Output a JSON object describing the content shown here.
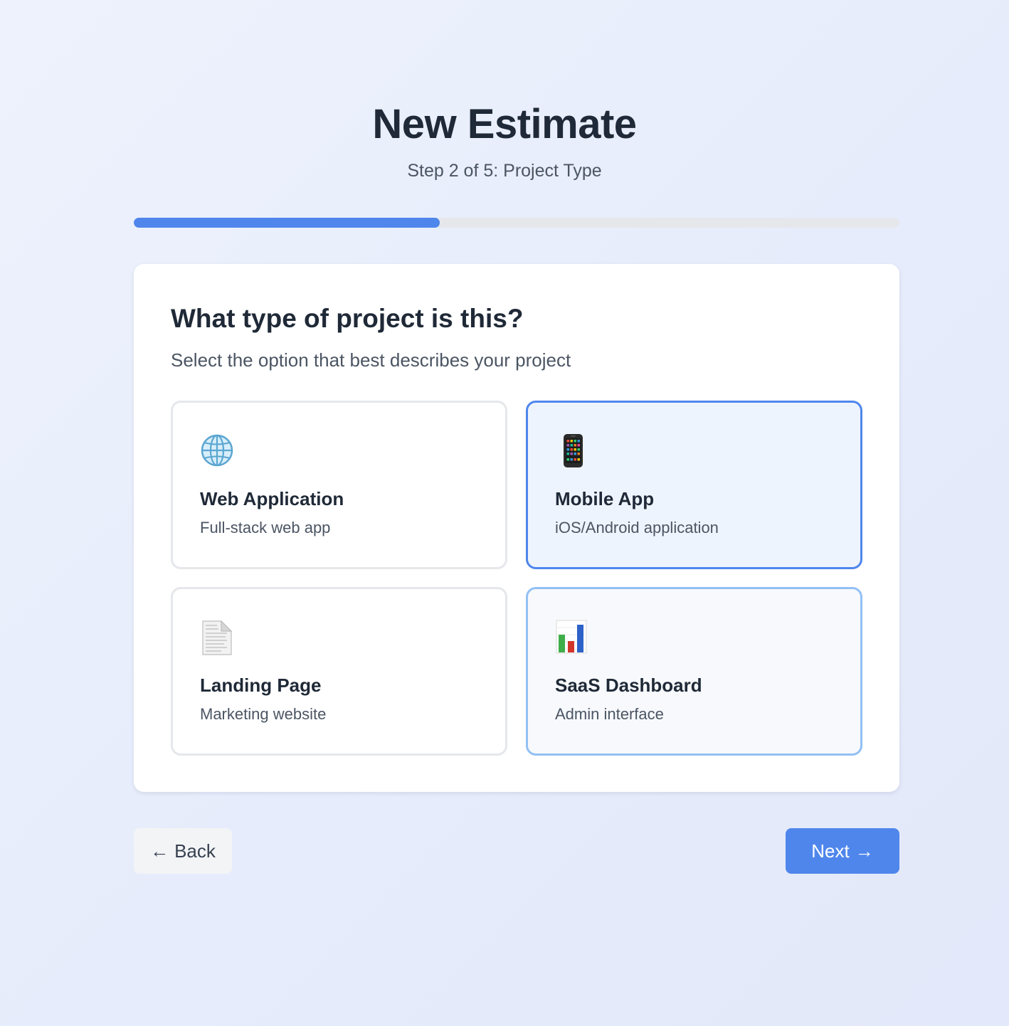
{
  "header": {
    "title": "New Estimate",
    "subtitle": "Step 2 of 5: Project Type"
  },
  "progress": {
    "current_step": 2,
    "total_steps": 5,
    "fill_fraction": 0.4
  },
  "question": {
    "title": "What type of project is this?",
    "description": "Select the option that best describes your project"
  },
  "options": [
    {
      "label": "Web Application",
      "description": "Full-stack web app",
      "icon": "globe-icon",
      "state": "default"
    },
    {
      "label": "Mobile App",
      "description": "iOS/Android application",
      "icon": "mobile-phone-icon",
      "state": "selected"
    },
    {
      "label": "Landing Page",
      "description": "Marketing website",
      "icon": "document-icon",
      "state": "default"
    },
    {
      "label": "SaaS Dashboard",
      "description": "Admin interface",
      "icon": "bar-chart-icon",
      "state": "hovered"
    }
  ],
  "navigation": {
    "back_arrow": "←",
    "back_label": "Back",
    "next_label": "Next",
    "next_arrow": "→"
  },
  "colors": {
    "accent": "#4f86ec",
    "selected_background": "#eef4fe",
    "hover_border": "#93c0f5",
    "track": "#e5e7eb",
    "text_primary": "#1f2937",
    "text_secondary": "#4b5563"
  }
}
